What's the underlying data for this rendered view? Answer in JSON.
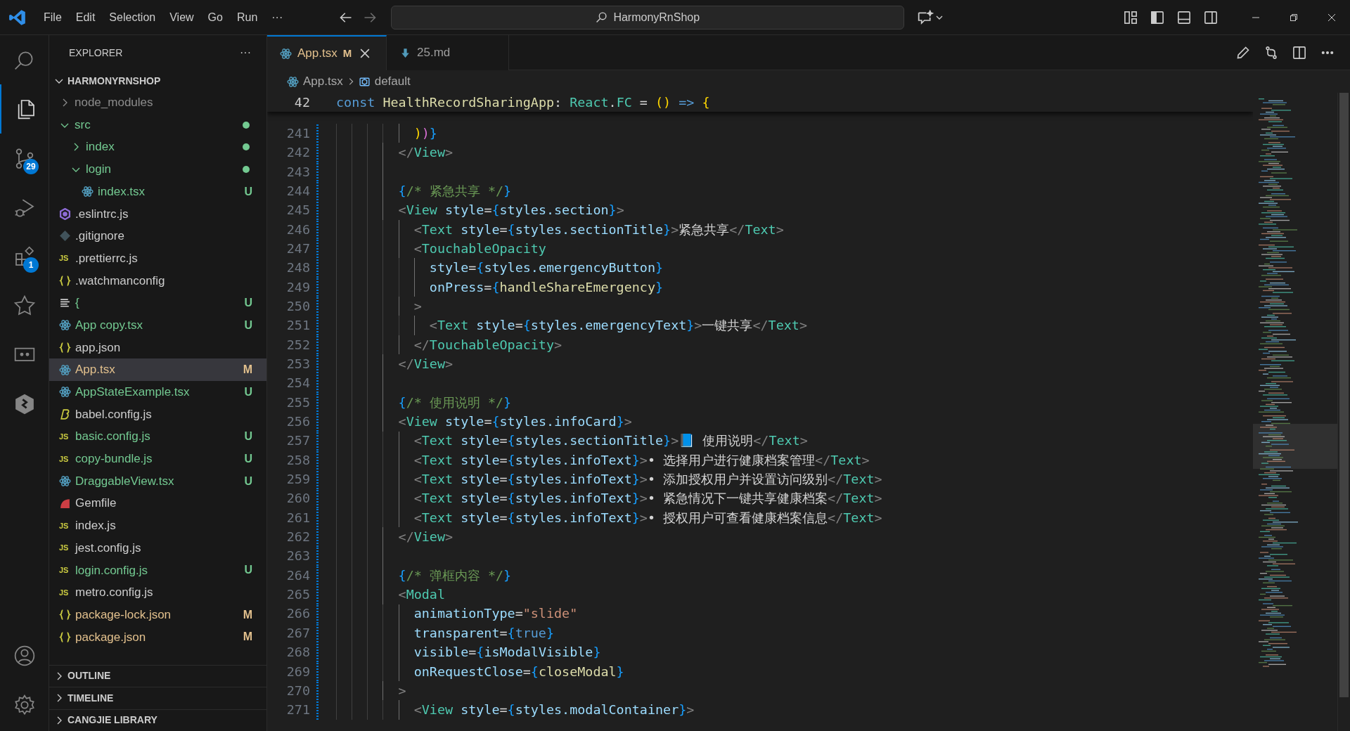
{
  "title_bar": {
    "menu": [
      "File",
      "Edit",
      "Selection",
      "View",
      "Go",
      "Run",
      "···"
    ],
    "search": "HarmonyRnShop"
  },
  "activity_bar": [
    {
      "kind": "search",
      "selected": false
    },
    {
      "kind": "explorer",
      "selected": true
    },
    {
      "kind": "source-control",
      "selected": false,
      "badge": "29"
    },
    {
      "kind": "run-debug",
      "selected": false
    },
    {
      "kind": "extensions",
      "selected": false,
      "badge": "1"
    },
    {
      "kind": "star",
      "selected": false
    },
    {
      "kind": "remote",
      "selected": false
    },
    {
      "kind": "hexagon",
      "selected": false
    }
  ],
  "activity_bottom": [
    {
      "kind": "account"
    },
    {
      "kind": "settings"
    }
  ],
  "explorer": {
    "title": "EXPLORER",
    "more": "···",
    "root": {
      "label": "HARMONYRNSHOP",
      "expanded": true
    },
    "items": [
      {
        "label": "node_modules",
        "kind": "folder",
        "expanded": false,
        "color": "#8c8c8c",
        "selected": false
      },
      {
        "label": "src",
        "kind": "folder",
        "expanded": true,
        "color": "#73c991",
        "dot": true,
        "selected": false,
        "children": [
          {
            "label": "index",
            "kind": "folder",
            "expanded": false,
            "color": "#73c991",
            "dot": true,
            "selected": false
          },
          {
            "label": "login",
            "kind": "folder",
            "expanded": true,
            "color": "#73c991",
            "dot": true,
            "selected": false,
            "children": [
              {
                "label": "index.tsx",
                "kind": "react",
                "color": "#73c991",
                "status": "U",
                "selected": false
              }
            ]
          }
        ]
      },
      {
        "label": ".eslintrc.js",
        "kind": "eslint",
        "color": "#cccccc",
        "selected": false
      },
      {
        "label": ".gitignore",
        "kind": "git",
        "color": "#cccccc",
        "selected": false
      },
      {
        "label": ".prettierrc.js",
        "kind": "js",
        "icon_text": "JS",
        "color": "#cccccc",
        "selected": false
      },
      {
        "label": ".watchmanconfig",
        "kind": "json",
        "color": "#cccccc",
        "selected": false
      },
      {
        "label": "{",
        "kind": "lines",
        "color": "#73c991",
        "status": "U",
        "selected": false
      },
      {
        "label": "App copy.tsx",
        "kind": "react",
        "color": "#73c991",
        "status": "U",
        "selected": false
      },
      {
        "label": "app.json",
        "kind": "json",
        "color": "#cccccc",
        "selected": false
      },
      {
        "label": "App.tsx",
        "kind": "react",
        "color": "#e2c08d",
        "status": "M",
        "selected": true
      },
      {
        "label": "AppStateExample.tsx",
        "kind": "react",
        "color": "#73c991",
        "status": "U",
        "selected": false
      },
      {
        "label": "babel.config.js",
        "kind": "babel",
        "color": "#cccccc",
        "selected": false
      },
      {
        "label": "basic.config.js",
        "kind": "js",
        "icon_text": "JS",
        "color": "#73c991",
        "status": "U",
        "selected": false
      },
      {
        "label": "copy-bundle.js",
        "kind": "js",
        "icon_text": "JS",
        "color": "#73c991",
        "status": "U",
        "selected": false
      },
      {
        "label": "DraggableView.tsx",
        "kind": "react",
        "color": "#73c991",
        "status": "U",
        "selected": false
      },
      {
        "label": "Gemfile",
        "kind": "ruby",
        "color": "#cccccc",
        "selected": false
      },
      {
        "label": "index.js",
        "kind": "js",
        "icon_text": "JS",
        "color": "#cccccc",
        "selected": false
      },
      {
        "label": "jest.config.js",
        "kind": "js",
        "icon_text": "JS",
        "color": "#cccccc",
        "selected": false
      },
      {
        "label": "login.config.js",
        "kind": "js",
        "icon_text": "JS",
        "color": "#73c991",
        "status": "U",
        "selected": false
      },
      {
        "label": "metro.config.js",
        "kind": "js",
        "icon_text": "JS",
        "color": "#cccccc",
        "selected": false
      },
      {
        "label": "package-lock.json",
        "kind": "json",
        "color": "#e2c08d",
        "status": "M",
        "selected": false
      },
      {
        "label": "package.json",
        "kind": "json",
        "color": "#e2c08d",
        "status": "M",
        "selected": false
      }
    ],
    "panels": [
      {
        "label": "OUTLINE",
        "expanded": false
      },
      {
        "label": "TIMELINE",
        "expanded": false
      },
      {
        "label": "CANGJIE LIBRARY",
        "expanded": false
      }
    ]
  },
  "tabs": [
    {
      "label": "App.tsx",
      "kind": "react",
      "status": "M",
      "selected": true
    },
    {
      "label": "25.md",
      "kind": "markdown",
      "selected": false
    }
  ],
  "breadcrumb": [
    {
      "label": "App.tsx",
      "kind": "react"
    },
    {
      "label": "default",
      "kind": "symbol"
    }
  ],
  "sticky": {
    "number": "42",
    "code": [
      {
        "kind": "keyword",
        "text": "const "
      },
      {
        "kind": "function",
        "text": "HealthRecordSharingApp"
      },
      {
        "kind": "plain",
        "text": ": "
      },
      {
        "kind": "type",
        "text": "React"
      },
      {
        "kind": "plain",
        "text": "."
      },
      {
        "kind": "type",
        "text": "FC"
      },
      {
        "kind": "plain",
        "text": " = "
      },
      {
        "kind": "brace-gold",
        "text": "() "
      },
      {
        "kind": "keyword",
        "text": "=> "
      },
      {
        "kind": "brace-gold",
        "text": "{"
      }
    ]
  },
  "lines": [
    {
      "number": "241",
      "code": [
        {
          "kind": "brace-gold",
          "text": "          )"
        },
        {
          "kind": "brace-pink",
          "text": ")"
        },
        {
          "kind": "brace-blue",
          "text": "}"
        }
      ]
    },
    {
      "number": "242",
      "code": [
        {
          "kind": "punct",
          "text": "        </"
        },
        {
          "kind": "tag",
          "text": "View"
        },
        {
          "kind": "punct",
          "text": ">"
        }
      ]
    },
    {
      "number": "243"
    },
    {
      "number": "244",
      "code": [
        {
          "kind": "brace-blue",
          "text": "        {"
        },
        {
          "kind": "comment",
          "text": "/* 紧急共享 */"
        },
        {
          "kind": "brace-blue",
          "text": "}"
        }
      ]
    },
    {
      "number": "245",
      "code": [
        {
          "kind": "punct",
          "text": "        <"
        },
        {
          "kind": "tag",
          "text": "View "
        },
        {
          "kind": "attr",
          "text": "style"
        },
        {
          "kind": "plain",
          "text": "="
        },
        {
          "kind": "brace-blue",
          "text": "{"
        },
        {
          "kind": "attr",
          "text": "styles.section"
        },
        {
          "kind": "brace-blue",
          "text": "}"
        },
        {
          "kind": "punct",
          "text": ">"
        }
      ]
    },
    {
      "number": "246",
      "code": [
        {
          "kind": "punct",
          "text": "          <"
        },
        {
          "kind": "tag",
          "text": "Text "
        },
        {
          "kind": "attr",
          "text": "style"
        },
        {
          "kind": "plain",
          "text": "="
        },
        {
          "kind": "brace-blue",
          "text": "{"
        },
        {
          "kind": "attr",
          "text": "styles.sectionTitle"
        },
        {
          "kind": "brace-blue",
          "text": "}"
        },
        {
          "kind": "punct",
          "text": ">"
        },
        {
          "kind": "plain",
          "text": "紧急共享"
        },
        {
          "kind": "punct",
          "text": "</"
        },
        {
          "kind": "tag",
          "text": "Text"
        },
        {
          "kind": "punct",
          "text": ">"
        }
      ]
    },
    {
      "number": "247",
      "code": [
        {
          "kind": "punct",
          "text": "          <"
        },
        {
          "kind": "tag",
          "text": "TouchableOpacity"
        }
      ]
    },
    {
      "number": "248",
      "code": [
        {
          "kind": "attr",
          "text": "            style"
        },
        {
          "kind": "plain",
          "text": "="
        },
        {
          "kind": "brace-blue",
          "text": "{"
        },
        {
          "kind": "attr",
          "text": "styles.emergencyButton"
        },
        {
          "kind": "brace-blue",
          "text": "}"
        }
      ]
    },
    {
      "number": "249",
      "code": [
        {
          "kind": "attr",
          "text": "            onPress"
        },
        {
          "kind": "plain",
          "text": "="
        },
        {
          "kind": "brace-blue",
          "text": "{"
        },
        {
          "kind": "function",
          "text": "handleShareEmergency"
        },
        {
          "kind": "brace-blue",
          "text": "}"
        }
      ]
    },
    {
      "number": "250",
      "code": [
        {
          "kind": "punct",
          "text": "          >"
        }
      ]
    },
    {
      "number": "251",
      "code": [
        {
          "kind": "punct",
          "text": "            <"
        },
        {
          "kind": "tag",
          "text": "Text "
        },
        {
          "kind": "attr",
          "text": "style"
        },
        {
          "kind": "plain",
          "text": "="
        },
        {
          "kind": "brace-blue",
          "text": "{"
        },
        {
          "kind": "attr",
          "text": "styles.emergencyText"
        },
        {
          "kind": "brace-blue",
          "text": "}"
        },
        {
          "kind": "punct",
          "text": ">"
        },
        {
          "kind": "plain",
          "text": "一键共享"
        },
        {
          "kind": "punct",
          "text": "</"
        },
        {
          "kind": "tag",
          "text": "Text"
        },
        {
          "kind": "punct",
          "text": ">"
        }
      ]
    },
    {
      "number": "252",
      "code": [
        {
          "kind": "punct",
          "text": "          </"
        },
        {
          "kind": "tag",
          "text": "TouchableOpacity"
        },
        {
          "kind": "punct",
          "text": ">"
        }
      ]
    },
    {
      "number": "253",
      "code": [
        {
          "kind": "punct",
          "text": "        </"
        },
        {
          "kind": "tag",
          "text": "View"
        },
        {
          "kind": "punct",
          "text": ">"
        }
      ]
    },
    {
      "number": "254"
    },
    {
      "number": "255",
      "code": [
        {
          "kind": "brace-blue",
          "text": "        {"
        },
        {
          "kind": "comment",
          "text": "/* 使用说明 */"
        },
        {
          "kind": "brace-blue",
          "text": "}"
        }
      ]
    },
    {
      "number": "256",
      "code": [
        {
          "kind": "punct",
          "text": "        <"
        },
        {
          "kind": "tag",
          "text": "View "
        },
        {
          "kind": "attr",
          "text": "style"
        },
        {
          "kind": "plain",
          "text": "="
        },
        {
          "kind": "brace-blue",
          "text": "{"
        },
        {
          "kind": "attr",
          "text": "styles.infoCard"
        },
        {
          "kind": "brace-blue",
          "text": "}"
        },
        {
          "kind": "punct",
          "text": ">"
        }
      ]
    },
    {
      "number": "257",
      "code": [
        {
          "kind": "punct",
          "text": "          <"
        },
        {
          "kind": "tag",
          "text": "Text "
        },
        {
          "kind": "attr",
          "text": "style"
        },
        {
          "kind": "plain",
          "text": "="
        },
        {
          "kind": "brace-blue",
          "text": "{"
        },
        {
          "kind": "attr",
          "text": "styles.sectionTitle"
        },
        {
          "kind": "brace-blue",
          "text": "}"
        },
        {
          "kind": "punct",
          "text": ">"
        },
        {
          "kind": "plain",
          "text": "📘 使用说明"
        },
        {
          "kind": "punct",
          "text": "</"
        },
        {
          "kind": "tag",
          "text": "Text"
        },
        {
          "kind": "punct",
          "text": ">"
        }
      ]
    },
    {
      "number": "258",
      "code": [
        {
          "kind": "punct",
          "text": "          <"
        },
        {
          "kind": "tag",
          "text": "Text "
        },
        {
          "kind": "attr",
          "text": "style"
        },
        {
          "kind": "plain",
          "text": "="
        },
        {
          "kind": "brace-blue",
          "text": "{"
        },
        {
          "kind": "attr",
          "text": "styles.infoText"
        },
        {
          "kind": "brace-blue",
          "text": "}"
        },
        {
          "kind": "punct",
          "text": ">"
        },
        {
          "kind": "plain",
          "text": "• 选择用户进行健康档案管理"
        },
        {
          "kind": "punct",
          "text": "</"
        },
        {
          "kind": "tag",
          "text": "Text"
        },
        {
          "kind": "punct",
          "text": ">"
        }
      ]
    },
    {
      "number": "259",
      "code": [
        {
          "kind": "punct",
          "text": "          <"
        },
        {
          "kind": "tag",
          "text": "Text "
        },
        {
          "kind": "attr",
          "text": "style"
        },
        {
          "kind": "plain",
          "text": "="
        },
        {
          "kind": "brace-blue",
          "text": "{"
        },
        {
          "kind": "attr",
          "text": "styles.infoText"
        },
        {
          "kind": "brace-blue",
          "text": "}"
        },
        {
          "kind": "punct",
          "text": ">"
        },
        {
          "kind": "plain",
          "text": "• 添加授权用户并设置访问级别"
        },
        {
          "kind": "punct",
          "text": "</"
        },
        {
          "kind": "tag",
          "text": "Text"
        },
        {
          "kind": "punct",
          "text": ">"
        }
      ]
    },
    {
      "number": "260",
      "code": [
        {
          "kind": "punct",
          "text": "          <"
        },
        {
          "kind": "tag",
          "text": "Text "
        },
        {
          "kind": "attr",
          "text": "style"
        },
        {
          "kind": "plain",
          "text": "="
        },
        {
          "kind": "brace-blue",
          "text": "{"
        },
        {
          "kind": "attr",
          "text": "styles.infoText"
        },
        {
          "kind": "brace-blue",
          "text": "}"
        },
        {
          "kind": "punct",
          "text": ">"
        },
        {
          "kind": "plain",
          "text": "• 紧急情况下一键共享健康档案"
        },
        {
          "kind": "punct",
          "text": "</"
        },
        {
          "kind": "tag",
          "text": "Text"
        },
        {
          "kind": "punct",
          "text": ">"
        }
      ]
    },
    {
      "number": "261",
      "code": [
        {
          "kind": "punct",
          "text": "          <"
        },
        {
          "kind": "tag",
          "text": "Text "
        },
        {
          "kind": "attr",
          "text": "style"
        },
        {
          "kind": "plain",
          "text": "="
        },
        {
          "kind": "brace-blue",
          "text": "{"
        },
        {
          "kind": "attr",
          "text": "styles.infoText"
        },
        {
          "kind": "brace-blue",
          "text": "}"
        },
        {
          "kind": "punct",
          "text": ">"
        },
        {
          "kind": "plain",
          "text": "• 授权用户可查看健康档案信息"
        },
        {
          "kind": "punct",
          "text": "</"
        },
        {
          "kind": "tag",
          "text": "Text"
        },
        {
          "kind": "punct",
          "text": ">"
        }
      ]
    },
    {
      "number": "262",
      "code": [
        {
          "kind": "punct",
          "text": "        </"
        },
        {
          "kind": "tag",
          "text": "View"
        },
        {
          "kind": "punct",
          "text": ">"
        }
      ]
    },
    {
      "number": "263"
    },
    {
      "number": "264",
      "code": [
        {
          "kind": "brace-blue",
          "text": "        {"
        },
        {
          "kind": "comment",
          "text": "/* 弹框内容 */"
        },
        {
          "kind": "brace-blue",
          "text": "}"
        }
      ]
    },
    {
      "number": "265",
      "code": [
        {
          "kind": "punct",
          "text": "        <"
        },
        {
          "kind": "tag",
          "text": "Modal"
        }
      ]
    },
    {
      "number": "266",
      "code": [
        {
          "kind": "attr",
          "text": "          animationType"
        },
        {
          "kind": "plain",
          "text": "="
        },
        {
          "kind": "string",
          "text": "\"slide\""
        }
      ]
    },
    {
      "number": "267",
      "code": [
        {
          "kind": "attr",
          "text": "          transparent"
        },
        {
          "kind": "plain",
          "text": "="
        },
        {
          "kind": "brace-blue",
          "text": "{"
        },
        {
          "kind": "keyword",
          "text": "true"
        },
        {
          "kind": "brace-blue",
          "text": "}"
        }
      ]
    },
    {
      "number": "268",
      "code": [
        {
          "kind": "attr",
          "text": "          visible"
        },
        {
          "kind": "plain",
          "text": "="
        },
        {
          "kind": "brace-blue",
          "text": "{"
        },
        {
          "kind": "attr",
          "text": "isModalVisible"
        },
        {
          "kind": "brace-blue",
          "text": "}"
        }
      ]
    },
    {
      "number": "269",
      "code": [
        {
          "kind": "attr",
          "text": "          onRequestClose"
        },
        {
          "kind": "plain",
          "text": "="
        },
        {
          "kind": "brace-blue",
          "text": "{"
        },
        {
          "kind": "function",
          "text": "closeModal"
        },
        {
          "kind": "brace-blue",
          "text": "}"
        }
      ]
    },
    {
      "number": "270",
      "code": [
        {
          "kind": "punct",
          "text": "        >"
        }
      ]
    },
    {
      "number": "271",
      "code": [
        {
          "kind": "punct",
          "text": "          <"
        },
        {
          "kind": "tag",
          "text": "View "
        },
        {
          "kind": "attr",
          "text": "style"
        },
        {
          "kind": "plain",
          "text": "="
        },
        {
          "kind": "brace-blue",
          "text": "{"
        },
        {
          "kind": "attr",
          "text": "styles.modalContainer"
        },
        {
          "kind": "brace-blue",
          "text": "}"
        },
        {
          "kind": "punct",
          "text": ">"
        }
      ]
    }
  ]
}
